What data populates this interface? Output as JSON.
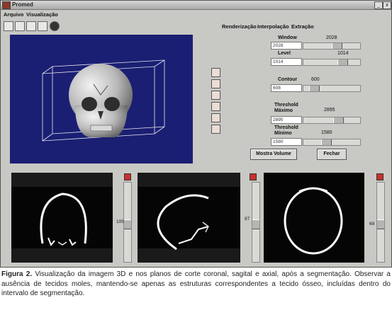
{
  "window": {
    "title": "Promed",
    "controls": [
      "_",
      "x"
    ]
  },
  "menubar": {
    "items": [
      "Arquivo",
      "Visualização"
    ]
  },
  "toolbar": {
    "icons": [
      "new-icon",
      "open-icon",
      "save-icon",
      "print-icon",
      "stop-icon"
    ]
  },
  "topmenu": {
    "items": [
      "Renderização",
      "Interpolação",
      "Extração"
    ]
  },
  "panel": {
    "window": {
      "label": "Window",
      "value": "2028",
      "field": "2028",
      "level": 0.6
    },
    "level": {
      "label": "Level",
      "value": "1014",
      "field": "1014",
      "level": 0.72
    },
    "contour": {
      "label": "Contour",
      "value": "600",
      "field": "608",
      "level": 0.12
    },
    "thr_max": {
      "label": "Threshold\nMáximo",
      "value": "2895",
      "field": "2895",
      "level": 0.62
    },
    "thr_min": {
      "label": "Threshold\nMínimo",
      "value": "1580",
      "field": "1580",
      "level": 0.37
    },
    "show_volume": "Mostra Volume",
    "close": "Fechar"
  },
  "slices": [
    {
      "name": "coronal",
      "value": "105",
      "level": 0.52
    },
    {
      "name": "sagittal",
      "value": "97",
      "level": 0.52
    },
    {
      "name": "axial",
      "value": "69",
      "level": 0.52
    }
  ],
  "caption": {
    "label": "Figura 2.",
    "text": " Visualização da imagem 3D e nos planos de corte coronal, sagital e axial, após a segmentação. Observar a ausência de tecidos moles, mantendo-se apenas as estruturas correspondentes a tecido ósseo, incluídas dentro do intervalo de segmentação."
  },
  "colors": {
    "viewport_bg": "#1b1f73",
    "window_bg": "#c8c8c4",
    "bone": "#ffffff"
  }
}
